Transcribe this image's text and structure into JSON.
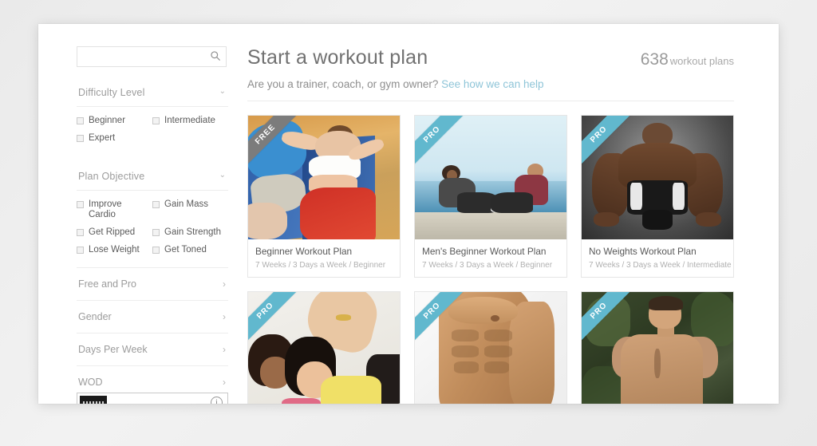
{
  "sidebar": {
    "search": {
      "value": "",
      "placeholder": "",
      "icon": "search-icon"
    },
    "groups": [
      {
        "title": "Difficulty Level",
        "expanded": true,
        "chevron": "⌄",
        "options": [
          {
            "label": "Beginner",
            "checked": false
          },
          {
            "label": "Intermediate",
            "checked": false
          },
          {
            "label": "Expert",
            "checked": false
          }
        ]
      },
      {
        "title": "Plan Objective",
        "expanded": true,
        "chevron": "⌄",
        "options": [
          {
            "label": "Improve Cardio",
            "checked": false
          },
          {
            "label": "Gain Mass",
            "checked": false
          },
          {
            "label": "Get Ripped",
            "checked": false
          },
          {
            "label": "Gain Strength",
            "checked": false
          },
          {
            "label": "Lose Weight",
            "checked": false
          },
          {
            "label": "Get Toned",
            "checked": false
          }
        ]
      }
    ],
    "collapsed_rows": [
      {
        "label": "Free and Pro",
        "chevron": "›"
      },
      {
        "label": "Gender",
        "chevron": "›"
      },
      {
        "label": "Days Per Week",
        "chevron": "›"
      },
      {
        "label": "WOD",
        "chevron": "›"
      }
    ],
    "ad_stub": {
      "info_glyph": "i"
    }
  },
  "main": {
    "title": "Start a workout plan",
    "count_number": "638",
    "count_label": "workout plans",
    "subtitle_text": "Are you a trainer, coach, or gym owner?",
    "subtitle_link": "See how we can help",
    "cards": [
      {
        "badge": "FREE",
        "badge_type": "free",
        "title": "Beginner Workout Plan",
        "meta": "7 Weeks / 3 Days a Week / Beginner",
        "photo": "ph1"
      },
      {
        "badge": "PRO",
        "badge_type": "pro",
        "title": "Men's Beginner Workout Plan",
        "meta": "7 Weeks / 3 Days a Week / Beginner",
        "photo": "ph2"
      },
      {
        "badge": "PRO",
        "badge_type": "pro",
        "title": "No Weights Workout Plan",
        "meta": "7 Weeks / 3 Days a Week / Intermediate",
        "photo": "ph3"
      },
      {
        "badge": "PRO",
        "badge_type": "pro",
        "title": "",
        "meta": "",
        "photo": "ph4"
      },
      {
        "badge": "PRO",
        "badge_type": "pro",
        "title": "",
        "meta": "",
        "photo": "ph5"
      },
      {
        "badge": "PRO",
        "badge_type": "pro",
        "title": "",
        "meta": "",
        "photo": "ph6"
      }
    ]
  },
  "colors": {
    "pro_badge": "#61b8ce",
    "free_badge": "#7c7c7c",
    "link": "#8fc5d8",
    "page_bg": "#ffffff",
    "canvas_bg": "#efefef",
    "title_text": "#717171",
    "muted_text": "#9c9c9c"
  }
}
